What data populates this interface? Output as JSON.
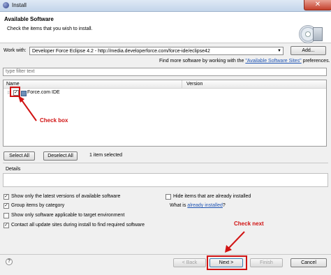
{
  "window": {
    "title": "Install",
    "close_label": "✕"
  },
  "header": {
    "title": "Available Software",
    "description": "Check the items that you wish to install."
  },
  "work_with": {
    "label": "Work with:",
    "value": "Developer Force Eclipse 4.2 - http://media.developerforce.com/force-ide/eclipse42",
    "add_label": "Add...",
    "more_prefix": "Find more software by working with the ",
    "more_link": "\"Available Software Sites\"",
    "more_suffix": " preferences."
  },
  "filter": {
    "placeholder": "type filter text"
  },
  "tree": {
    "columns": [
      "Name",
      "Version"
    ],
    "items": [
      {
        "name": "Force.com IDE",
        "version": "",
        "checked": true
      }
    ]
  },
  "annotations": {
    "checkbox": "Check box",
    "next": "Check next",
    "color": "#d11313"
  },
  "selection": {
    "select_all": "Select All",
    "deselect_all": "Deselect All",
    "status": "1 item selected"
  },
  "details": {
    "label": "Details"
  },
  "options": {
    "latest_versions": {
      "label": "Show only the latest versions of available software",
      "checked": true
    },
    "hide_installed": {
      "label": "Hide items that are already installed",
      "checked": false
    },
    "group_by_category": {
      "label": "Group items by category",
      "checked": true
    },
    "already_installed_prefix": "What is ",
    "already_installed_link": "already installed",
    "already_installed_suffix": "?",
    "target_env": {
      "label": "Show only software applicable to target environment",
      "checked": false
    },
    "contact_sites": {
      "label": "Contact all update sites during install to find required software",
      "checked": true
    }
  },
  "footer": {
    "help": "?",
    "back": "< Back",
    "next": "Next >",
    "finish": "Finish",
    "cancel": "Cancel"
  }
}
